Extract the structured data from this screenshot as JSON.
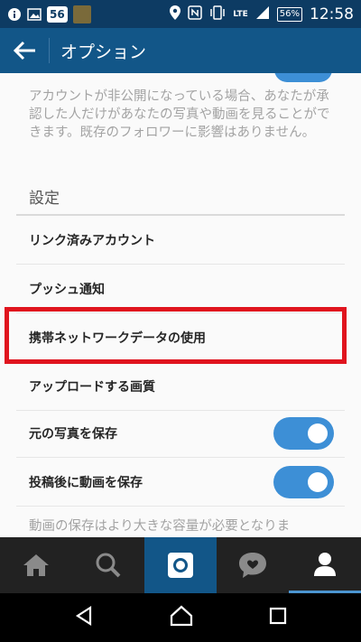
{
  "status_bar": {
    "badge": "56",
    "network": "LTE",
    "battery": "56%",
    "time": "12:58"
  },
  "app_bar": {
    "title": "オプション"
  },
  "privacy_description": "アカウントが非公開になっている場合、あなたが承認した人だけがあなたの写真や動画を見ることができます。既存のフォロワーに影響はありません。",
  "settings": {
    "section_title": "設定",
    "items": [
      {
        "label": "リンク済みアカウント",
        "has_toggle": false
      },
      {
        "label": "プッシュ通知",
        "has_toggle": false
      },
      {
        "label": "携帯ネットワークデータの使用",
        "has_toggle": false
      },
      {
        "label": "アップロードする画質",
        "has_toggle": false
      },
      {
        "label": "元の写真を保存",
        "has_toggle": true,
        "toggle_on": true
      },
      {
        "label": "投稿後に動画を保存",
        "has_toggle": true,
        "toggle_on": true
      }
    ]
  },
  "video_description": "動画の保存はより大きな容量が必要となりま",
  "bottom_nav": [
    "home-icon",
    "search-icon",
    "camera-icon",
    "activity-heart-icon",
    "profile-icon"
  ],
  "colors": {
    "app_bar": "#125688",
    "status_bar": "#0d3b63",
    "toggle_on": "#3d8fd6",
    "highlight": "#e0141e",
    "bottom_nav": "#222222"
  }
}
